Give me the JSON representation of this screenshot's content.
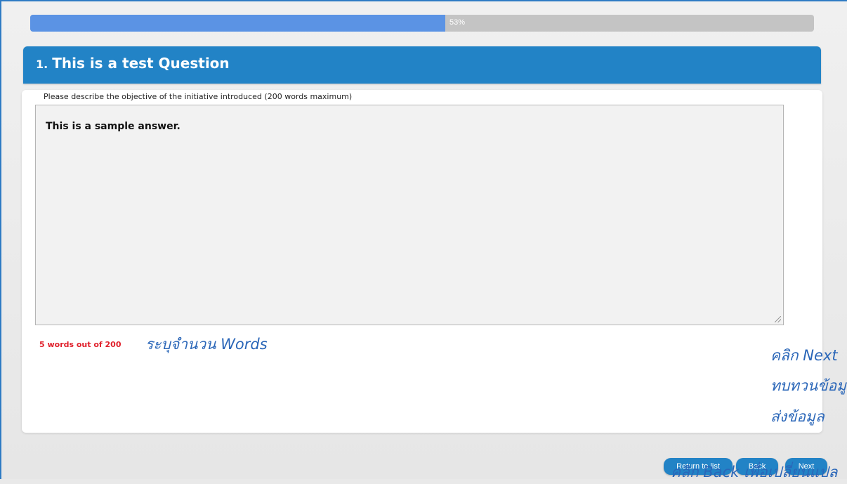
{
  "progress": {
    "value_percent": 53,
    "label": "53%"
  },
  "question": {
    "number": "1.",
    "title": "This is a test Question",
    "prompt": "Please describe the objective of the initiative introduced (200 words maximum)",
    "answer": "This is a sample answer.",
    "word_count": "5 words out of 200"
  },
  "annotations": {
    "words": "ระบุจำนวน Words",
    "next_line1": "คลิก Next",
    "next_line2": "ทบทวนข้อมู",
    "next_line3": "ส่งข้อมูล",
    "back": "คลิก Back เพื่อเปลี่ยนแปล"
  },
  "buttons": {
    "return_label": "Return to list",
    "back_label": "Back",
    "next_label": "Next"
  },
  "colors": {
    "accent": "#2283c6",
    "progress_fill": "#5b93e4",
    "word_count": "#e0202b",
    "annotation": "#2a66b8"
  }
}
